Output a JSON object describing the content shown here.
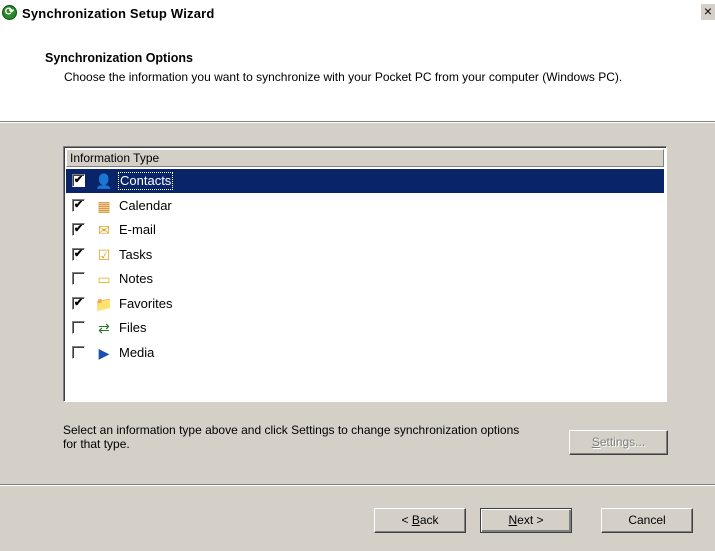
{
  "window": {
    "title": "Synchronization Setup Wizard",
    "close_glyph": "×",
    "app_icon": "activesync-icon",
    "app_glyph": "⟳"
  },
  "header": {
    "title": "Synchronization Options",
    "description": "Choose the information you want to synchronize with your Pocket PC from your computer (Windows PC)."
  },
  "list": {
    "column_header": "Information Type",
    "items": [
      {
        "label": "Contacts",
        "checked": true,
        "selected": true,
        "icon": "contacts-icon",
        "glyph": "👤",
        "color": "#3a5fb0"
      },
      {
        "label": "Calendar",
        "checked": true,
        "selected": false,
        "icon": "calendar-icon",
        "glyph": "▦",
        "color": "#d08a20"
      },
      {
        "label": "E-mail",
        "checked": true,
        "selected": false,
        "icon": "email-icon",
        "glyph": "✉",
        "color": "#e0a020"
      },
      {
        "label": "Tasks",
        "checked": true,
        "selected": false,
        "icon": "tasks-icon",
        "glyph": "☑",
        "color": "#e0a020"
      },
      {
        "label": "Notes",
        "checked": false,
        "selected": false,
        "icon": "notes-icon",
        "glyph": "▭",
        "color": "#e8b020"
      },
      {
        "label": "Favorites",
        "checked": true,
        "selected": false,
        "icon": "favorites-icon",
        "glyph": "📁",
        "color": "#e8b020"
      },
      {
        "label": "Files",
        "checked": false,
        "selected": false,
        "icon": "files-icon",
        "glyph": "⇄",
        "color": "#2a7a2a"
      },
      {
        "label": "Media",
        "checked": false,
        "selected": false,
        "icon": "media-icon",
        "glyph": "▶",
        "color": "#1a4fb0"
      }
    ],
    "check_glyph": "✔"
  },
  "info_text": "Select an information type above and click Settings to change synchronization options for that type.",
  "buttons": {
    "settings": "Settings...",
    "back": "< Back",
    "next": "Next >",
    "cancel": "Cancel"
  },
  "colors": {
    "selection": "#0a246a",
    "dialog_face": "#d4d0c8"
  }
}
